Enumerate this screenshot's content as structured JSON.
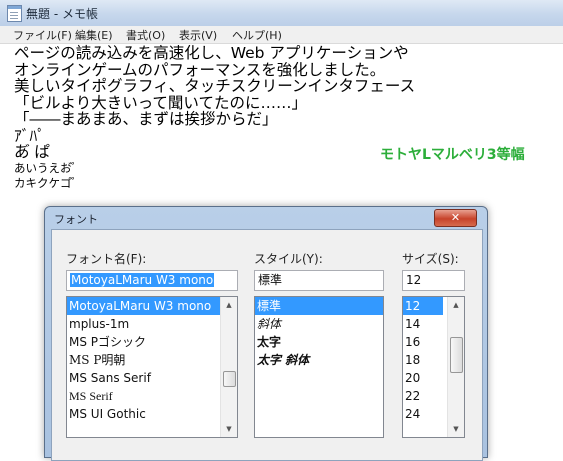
{
  "notepad": {
    "title": "無題 - メモ帳",
    "menu": [
      "ファイル(F)",
      "編集(E)",
      "書式(O)",
      "表示(V)",
      "ヘルプ(H)"
    ],
    "lines": [
      "ページの読み込みを高速化し、Web アプリケーションや",
      "オンラインゲームのパフォーマンスを強化しました。",
      "美しいタイポグラフィ、タッチスクリーンインタフェース",
      "「ビルより大きいって聞いてたのに……」",
      "「――まあまあ、まずは挨拶からだ」",
      "ｱﾞﾊﾟ",
      "あ゙ ぱ",
      "あいうえお゙ ゚",
      "カキクケコ゚ ゚"
    ],
    "font_overlay_label": "モトヤLマルベリ3等幅"
  },
  "dialog": {
    "title": "フォント",
    "close_glyph": "✕",
    "font": {
      "label": "フォント名(F):",
      "value": "MotoyaLMaru W3 mono",
      "items": [
        "MotoyaLMaru W3 mono",
        "mplus-1m",
        "MS Pゴシック",
        "MS P明朝",
        "MS Sans Serif",
        "MS Serif",
        "MS UI Gothic"
      ]
    },
    "style": {
      "label": "スタイル(Y):",
      "value": "標準",
      "items": [
        "標準",
        "斜体",
        "太字",
        "太字 斜体"
      ]
    },
    "size": {
      "label": "サイズ(S):",
      "value": "12",
      "items": [
        "12",
        "14",
        "16",
        "18",
        "20",
        "22",
        "24"
      ]
    },
    "scroll_up_glyph": "▲",
    "scroll_down_glyph": "▼"
  },
  "colors": {
    "selection": "#3399ff",
    "overlay_green": "#2cae3a"
  }
}
